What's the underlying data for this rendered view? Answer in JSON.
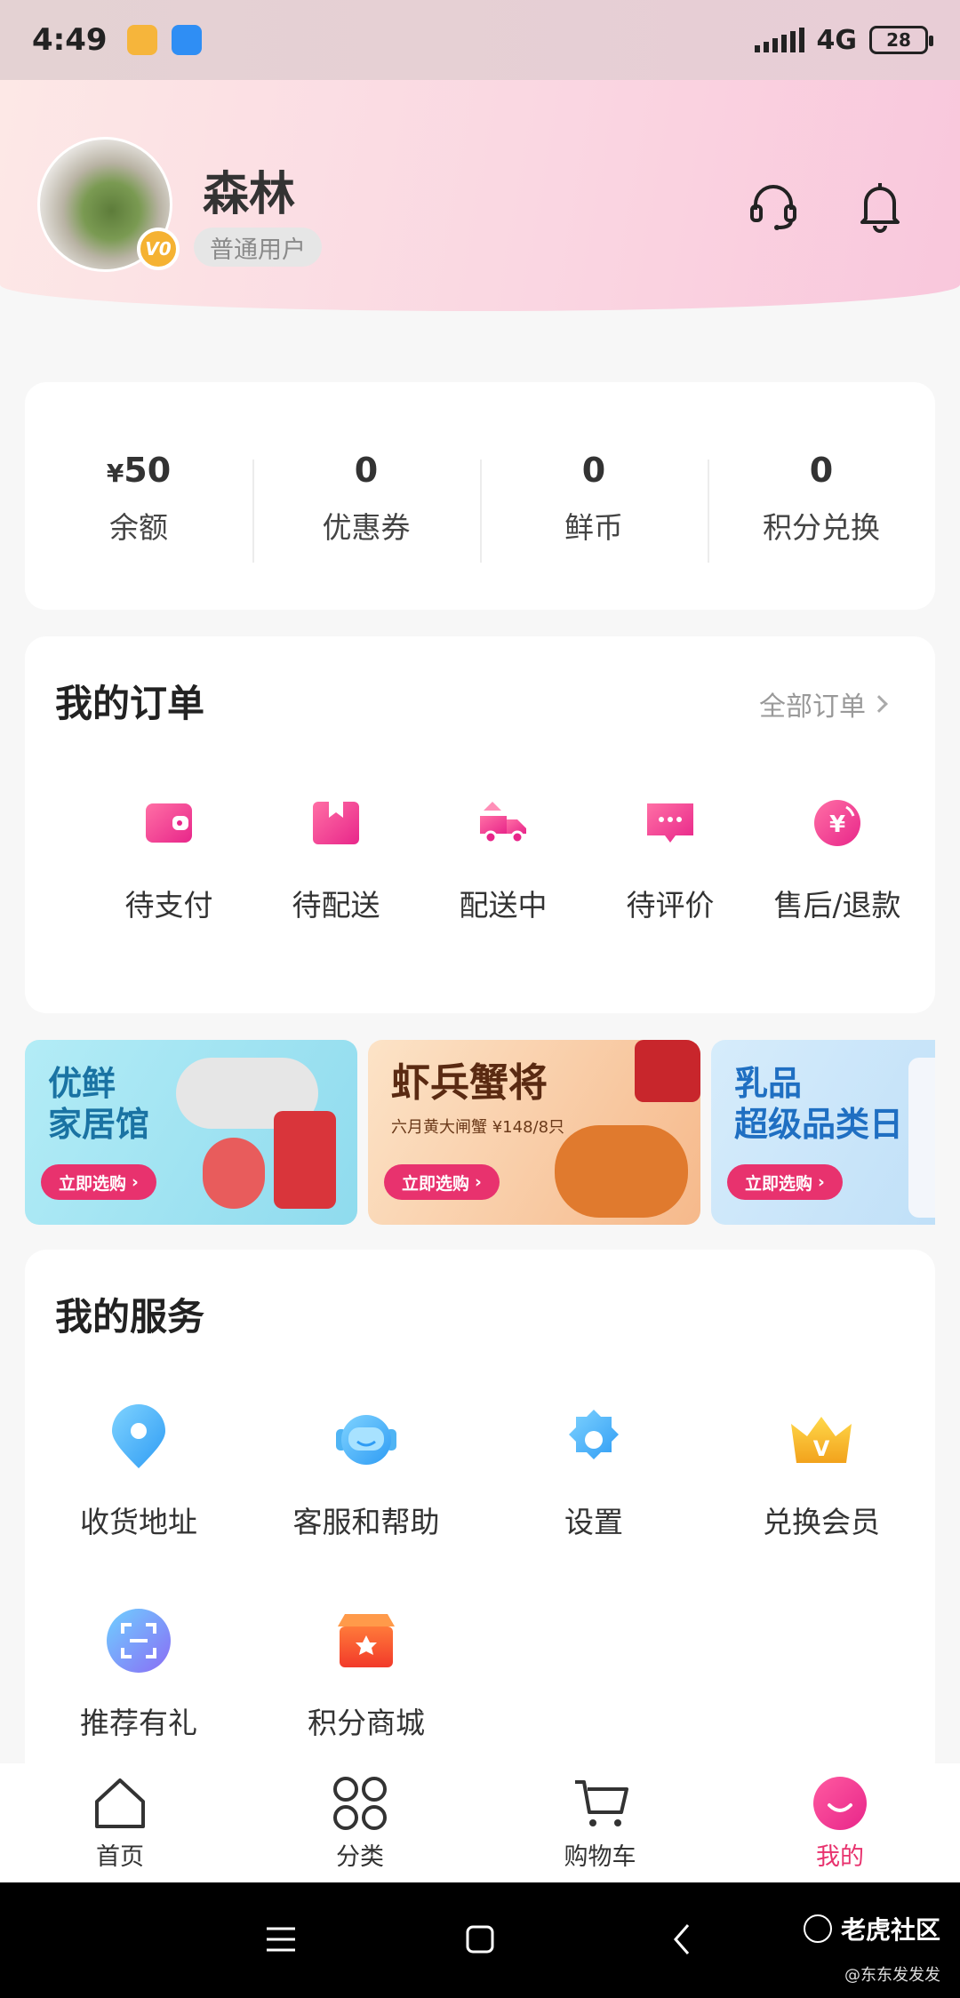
{
  "status_bar": {
    "time": "4:49",
    "network": "4G",
    "battery": "28"
  },
  "profile": {
    "name": "森林",
    "level": "普通用户",
    "vip_badge": "V0"
  },
  "stats": [
    {
      "value": "50",
      "prefix": "¥",
      "label": "余额"
    },
    {
      "value": "0",
      "prefix": "",
      "label": "优惠券"
    },
    {
      "value": "0",
      "prefix": "",
      "label": "鲜币"
    },
    {
      "value": "0",
      "prefix": "",
      "label": "积分兑换"
    }
  ],
  "orders": {
    "title": "我的订单",
    "all_link": "全部订单",
    "items": [
      {
        "label": "待支付",
        "icon": "wallet-icon"
      },
      {
        "label": "待配送",
        "icon": "package-icon"
      },
      {
        "label": "配送中",
        "icon": "delivery-truck-icon"
      },
      {
        "label": "待评价",
        "icon": "comment-icon"
      },
      {
        "label": "售后/退款",
        "icon": "refund-icon"
      }
    ]
  },
  "banners": [
    {
      "title_line1": "优鲜",
      "title_line2": "家居馆",
      "subtitle": "",
      "button": "立即选购"
    },
    {
      "title_line1": "虾兵蟹将",
      "title_line2": "",
      "subtitle": "六月黄大闸蟹 ¥148/8只",
      "button": "立即选购"
    },
    {
      "title_line1": "乳品",
      "title_line2": "超级品类日",
      "subtitle": "",
      "button": "立即选购"
    }
  ],
  "services": {
    "title": "我的服务",
    "items": [
      {
        "label": "收货地址",
        "icon": "location-pin-icon"
      },
      {
        "label": "客服和帮助",
        "icon": "customer-service-icon"
      },
      {
        "label": "设置",
        "icon": "settings-gear-icon"
      },
      {
        "label": "兑换会员",
        "icon": "vip-crown-icon"
      },
      {
        "label": "推荐有礼",
        "icon": "scan-icon"
      },
      {
        "label": "积分商城",
        "icon": "points-store-icon"
      }
    ]
  },
  "tabbar": [
    {
      "label": "首页",
      "icon": "home-icon",
      "active": false
    },
    {
      "label": "分类",
      "icon": "category-grid-icon",
      "active": false
    },
    {
      "label": "购物车",
      "icon": "cart-icon",
      "active": false
    },
    {
      "label": "我的",
      "icon": "smile-profile-icon",
      "active": true
    }
  ],
  "watermark": {
    "brand": "老虎社区",
    "handle": "@东东发发发"
  },
  "colors": {
    "accent": "#e8326e",
    "header_pink": "#fad7e2",
    "banner_blue": "#8fdbee"
  }
}
